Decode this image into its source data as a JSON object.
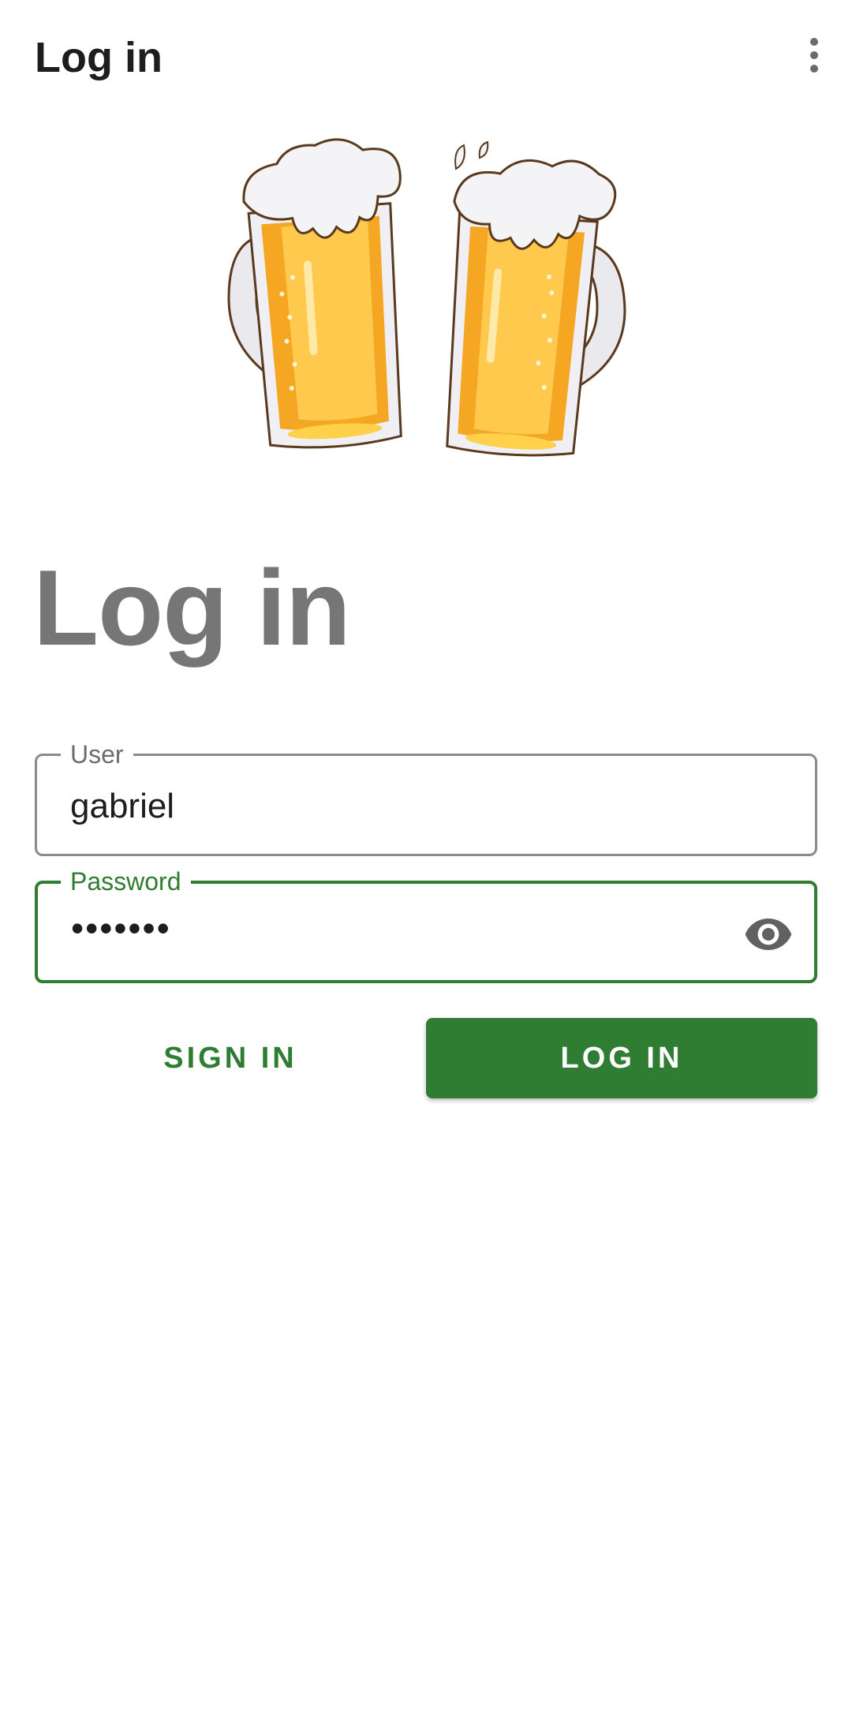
{
  "app_bar": {
    "title": "Log in",
    "overflow_icon": "more-vert-icon"
  },
  "hero": {
    "image": "beer-mugs-toast-illustration"
  },
  "heading": "Log in",
  "form": {
    "user": {
      "label": "User",
      "value": "gabriel"
    },
    "password": {
      "label": "Password",
      "value": "•••••••",
      "toggle_icon": "eye-icon"
    }
  },
  "actions": {
    "sign_in_label": "SIGN IN",
    "log_in_label": "LOG IN"
  },
  "colors": {
    "accent": "#2e7d32",
    "heading": "#767676",
    "text": "#1d1d1d"
  }
}
